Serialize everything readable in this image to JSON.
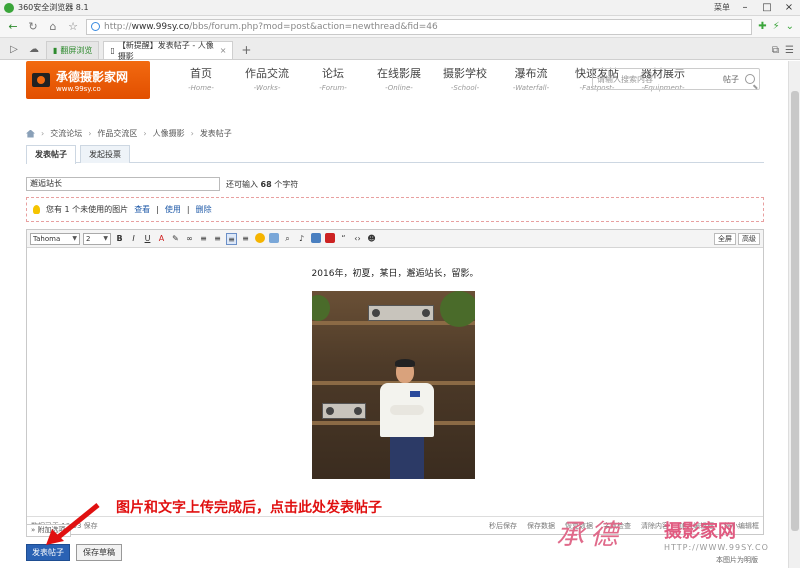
{
  "browser": {
    "title": "360安全浏览器 8.1",
    "menu_label": "菜单",
    "url_host": "www.99sy.co",
    "url_path": "/bbs/forum.php?mod=post&action=newthread&fid=46",
    "url_scheme": "http://",
    "tabs": [
      {
        "label": "翻屏浏览"
      },
      {
        "label": "【新提醒】发表帖子 - 人像摄影"
      }
    ]
  },
  "site": {
    "logo_name": "承德摄影家网",
    "logo_url": "www.99sy.co",
    "nav": [
      {
        "zh": "首页",
        "en": "-Home-"
      },
      {
        "zh": "作品交流",
        "en": "-Works-"
      },
      {
        "zh": "论坛",
        "en": "-Forum-"
      },
      {
        "zh": "在线影展",
        "en": "-Online-"
      },
      {
        "zh": "摄影学校",
        "en": "-School-"
      },
      {
        "zh": "瀑布流",
        "en": "-Waterfall-"
      },
      {
        "zh": "快速发帖",
        "en": "-Fastpost-"
      },
      {
        "zh": "器材展示",
        "en": "-Equipment-"
      }
    ],
    "search_placeholder": "请输入搜索内容",
    "search_scope": "帖子"
  },
  "breadcrumb": [
    "交流论坛",
    "作品交流区",
    "人像摄影",
    "发表帖子"
  ],
  "post_tabs": [
    {
      "label": "发表帖子",
      "active": true
    },
    {
      "label": "发起投票",
      "active": false
    }
  ],
  "form": {
    "subject_value": "邂逅站长",
    "remain_prefix": "还可输入",
    "remain_count": "68",
    "remain_suffix": "个字符",
    "attach_note": "您有 1 个未使用的图片",
    "attach_view": "查看",
    "attach_use": "使用",
    "attach_delete": "删除"
  },
  "editor": {
    "font_family": "Tahoma",
    "font_size": "2",
    "fullscreen_label": "全屏",
    "advanced_label": "高级",
    "caption": "2016年，初夏，某日，邂逅站长，留影。",
    "status_left": "数据已于 10:53 保存",
    "status_right": [
      "秒后保存",
      "保存数据",
      "恢复数据",
      "字数检查",
      "清除内容",
      "加大编辑框",
      "缩小编辑框"
    ]
  },
  "buttons": {
    "attach_options": "附加选项",
    "submit": "发表帖子",
    "draft": "保存草稿"
  },
  "annotation": "图片和文字上传完成后，点击此处发表帖子",
  "watermark": {
    "callig": "承德",
    "name": "摄影家网",
    "url": "HTTP://WWW.99SY.CO",
    "sub": "本图片为明版"
  },
  "colors": {
    "brand_orange": "#f26a10",
    "submit_blue": "#2a62b4",
    "annotation_red": "#e01010"
  }
}
